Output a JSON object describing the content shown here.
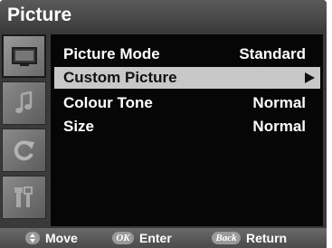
{
  "header": {
    "title": "Picture"
  },
  "sidebar": {
    "tabs": [
      {
        "icon": "monitor-icon",
        "active": true
      },
      {
        "icon": "music-note-icon",
        "active": false
      },
      {
        "icon": "refresh-icon",
        "active": false
      },
      {
        "icon": "tools-icon",
        "active": false
      }
    ]
  },
  "menu": {
    "items": [
      {
        "label": "Picture Mode",
        "value": "Standard"
      },
      {
        "label": "Custom Picture",
        "value": "",
        "selected": true,
        "submenu_arrow": "arrow-right-icon"
      },
      {
        "label": "Colour Tone",
        "value": "Normal"
      },
      {
        "label": "Size",
        "value": "Normal"
      }
    ]
  },
  "help_bar": {
    "move": {
      "key_icon": "up-down-key-icon",
      "label": "Move"
    },
    "enter": {
      "key": "OK",
      "label": "Enter"
    },
    "return": {
      "key": "Back",
      "label": "Return"
    }
  },
  "colors": {
    "panel_background": "#060606",
    "selection_background": "#c8c8c8",
    "frame": "#3a3a3a"
  }
}
